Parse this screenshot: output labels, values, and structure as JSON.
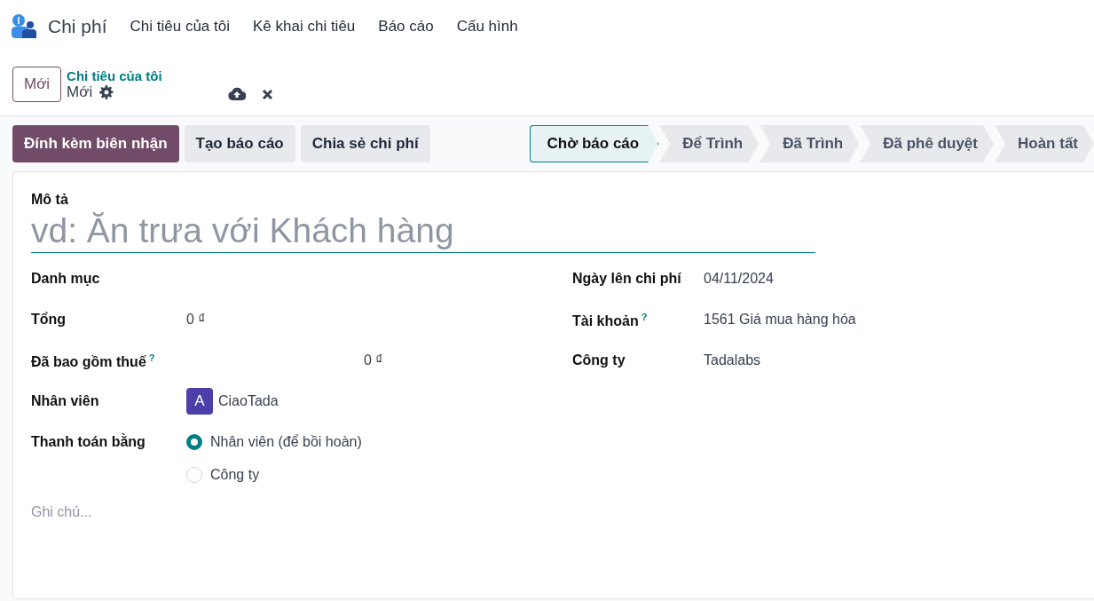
{
  "app": {
    "name": "Chi phí"
  },
  "menu": [
    {
      "label": "Chi tiêu của tôi"
    },
    {
      "label": "Kê khai chi tiêu"
    },
    {
      "label": "Báo cáo"
    },
    {
      "label": "Cấu hình"
    }
  ],
  "control_panel": {
    "new_button": "Mới",
    "breadcrumb": "Chi tiêu của tôi",
    "record_name": "Mới"
  },
  "actions": [
    {
      "label": "Đính kèm biên nhận",
      "kind": "primary"
    },
    {
      "label": "Tạo báo cáo",
      "kind": "secondary"
    },
    {
      "label": "Chia sẻ chi phí",
      "kind": "secondary"
    }
  ],
  "stages": [
    {
      "label": "Chờ báo cáo",
      "selected": true
    },
    {
      "label": "Để Trình",
      "selected": false
    },
    {
      "label": "Đã Trình",
      "selected": false
    },
    {
      "label": "Đã phê duyệt",
      "selected": false
    },
    {
      "label": "Hoàn tất",
      "selected": false
    }
  ],
  "form": {
    "description": {
      "label": "Mô tả",
      "placeholder": "vd: Ăn trưa với Khách hàng"
    },
    "left_fields": [
      {
        "label": "Danh mục",
        "kind": "text"
      },
      {
        "label": "Tổng",
        "kind": "text",
        "value": "0 ₫"
      },
      {
        "label": "Đã bao gồm thuế",
        "help": "?",
        "kind": "offset",
        "value": "0 ₫"
      },
      {
        "label": "Nhân viên",
        "kind": "avatar",
        "avatar": "A",
        "value": "CiaoTada"
      },
      {
        "label": "Thanh toán bằng",
        "kind": "radio",
        "options": [
          {
            "label": "Nhân viên (để bồi hoàn)",
            "selected": true
          },
          {
            "label": "Công ty",
            "selected": false
          }
        ]
      }
    ],
    "right_fields": [
      {
        "label": "Ngày lên chi phí",
        "kind": "text",
        "value": "04/11/2024"
      },
      {
        "label": "Tài khoản",
        "help": "?",
        "kind": "text",
        "value": "1561 Giá mua hàng hóa"
      },
      {
        "label": "Công ty",
        "kind": "text",
        "value": "Tadalabs"
      }
    ],
    "notes": {
      "placeholder": "Ghi chú..."
    }
  }
}
